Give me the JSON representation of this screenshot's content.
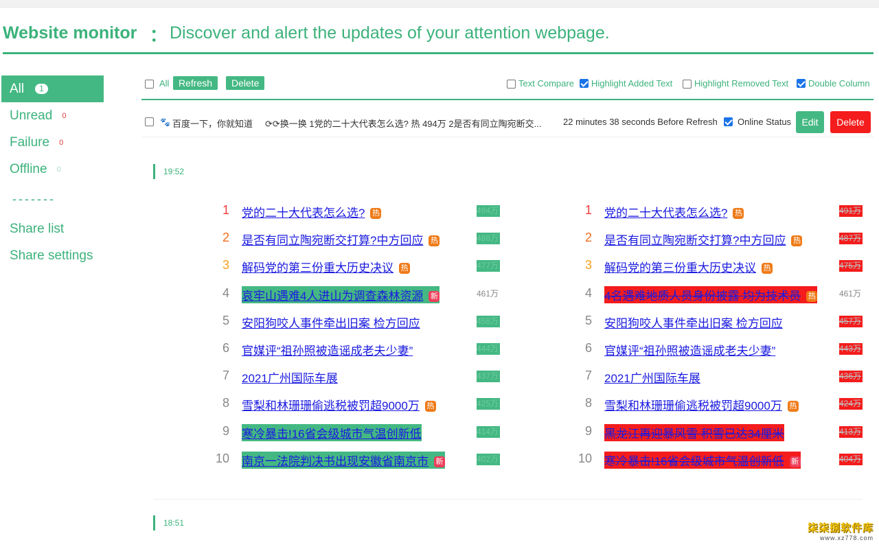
{
  "header": {
    "title": "Website monitor",
    "separator": "：",
    "description": "Discover and alert the updates of your attention webpage."
  },
  "sidebar": {
    "items": [
      {
        "label": "All",
        "count": "1"
      },
      {
        "label": "Unread",
        "count": "0"
      },
      {
        "label": "Failure",
        "count": "0"
      },
      {
        "label": "Offline",
        "count": "0"
      }
    ],
    "separator": "-------",
    "links": [
      "Share list",
      "Share settings"
    ]
  },
  "toolbar": {
    "all_label": "All",
    "refresh_label": "Refresh",
    "delete_label": "Delete",
    "options": [
      {
        "label": "Text Compare",
        "checked": false
      },
      {
        "label": "Highlight Added Text",
        "checked": true
      },
      {
        "label": "Highlight Removed Text",
        "checked": false
      },
      {
        "label": "Double Column",
        "checked": true
      }
    ]
  },
  "item": {
    "favicon": "baidu-paw-icon",
    "site_name": "百度一下，你就知道",
    "snippet": "⟳⟳换一换 1党的二十大代表怎么选? 热 494万 2是否有同立陶宛断交...",
    "before_refresh": "22 minutes 38 seconds Before Refresh",
    "online_status_label": "Online Status",
    "online_checked": true,
    "edit_label": "Edit",
    "delete_label": "Delete"
  },
  "snapshots": [
    {
      "time": "19:52"
    },
    {
      "time": "18:51"
    }
  ],
  "left_list": [
    {
      "rank": "1",
      "title": "党的二十大代表怎么选?",
      "tag": "热",
      "tag_type": "hot",
      "state": "normal",
      "value": "494万",
      "value_state": "added"
    },
    {
      "rank": "2",
      "title": "是否有同立陶宛断交打算?中方回应",
      "tag": "热",
      "tag_type": "hot",
      "state": "normal",
      "value": "488万",
      "value_state": "added"
    },
    {
      "rank": "3",
      "title": "解码党的第三份重大历史决议",
      "tag": "热",
      "tag_type": "hot",
      "state": "normal",
      "value": "477万",
      "value_state": "added"
    },
    {
      "rank": "4",
      "title": "哀牢山遇难4人进山为调查森林资源",
      "tag": "新",
      "tag_type": "new",
      "state": "added",
      "value": "461万",
      "value_state": "normal"
    },
    {
      "rank": "5",
      "title": "安阳狗咬人事件牵出旧案 检方回应",
      "tag": "",
      "tag_type": "",
      "state": "normal",
      "value": "458万",
      "value_state": "added"
    },
    {
      "rank": "6",
      "title": "官媒评“祖孙照被造谣成老夫少妻”",
      "tag": "",
      "tag_type": "",
      "state": "normal",
      "value": "444万",
      "value_state": "added"
    },
    {
      "rank": "7",
      "title": "2021广州国际车展",
      "tag": "",
      "tag_type": "",
      "state": "normal",
      "value": "437万",
      "value_state": "added"
    },
    {
      "rank": "8",
      "title": "雪梨和林珊珊偷逃税被罚超9000万",
      "tag": "热",
      "tag_type": "hot",
      "state": "normal",
      "value": "425万",
      "value_state": "added"
    },
    {
      "rank": "9",
      "title": "寒冷暴击!16省会级城市气温创新低",
      "tag": "",
      "tag_type": "",
      "state": "added",
      "value": "414万",
      "value_state": "added"
    },
    {
      "rank": "10",
      "title": "南京一法院判决书出现安徽省南京市",
      "tag": "新",
      "tag_type": "new",
      "state": "added",
      "value": "402万",
      "value_state": "added"
    }
  ],
  "right_list": [
    {
      "rank": "1",
      "title": "党的二十大代表怎么选?",
      "tag": "热",
      "tag_type": "hot",
      "state": "normal",
      "value": "491万",
      "value_state": "removed"
    },
    {
      "rank": "2",
      "title": "是否有同立陶宛断交打算?中方回应",
      "tag": "热",
      "tag_type": "hot",
      "state": "normal",
      "value": "487万",
      "value_state": "removed"
    },
    {
      "rank": "3",
      "title": "解码党的第三份重大历史决议",
      "tag": "热",
      "tag_type": "hot",
      "state": "normal",
      "value": "475万",
      "value_state": "removed"
    },
    {
      "rank": "4",
      "title": "4名遇难地质人员身份披露 均为技术员",
      "tag": "热",
      "tag_type": "hot",
      "state": "removed",
      "value": "461万",
      "value_state": "normal"
    },
    {
      "rank": "5",
      "title": "安阳狗咬人事件牵出旧案 检方回应",
      "tag": "",
      "tag_type": "",
      "state": "normal",
      "value": "457万",
      "value_state": "removed"
    },
    {
      "rank": "6",
      "title": "官媒评“祖孙照被造谣成老夫少妻”",
      "tag": "",
      "tag_type": "",
      "state": "normal",
      "value": "443万",
      "value_state": "removed"
    },
    {
      "rank": "7",
      "title": "2021广州国际车展",
      "tag": "",
      "tag_type": "",
      "state": "normal",
      "value": "436万",
      "value_state": "removed"
    },
    {
      "rank": "8",
      "title": "雪梨和林珊珊偷逃税被罚超9000万",
      "tag": "热",
      "tag_type": "hot",
      "state": "normal",
      "value": "424万",
      "value_state": "removed"
    },
    {
      "rank": "9",
      "title": "黑龙江再迎暴风雪 积雪已达34厘米",
      "tag": "",
      "tag_type": "",
      "state": "removed",
      "value": "413万",
      "value_state": "removed"
    },
    {
      "rank": "10",
      "title": "寒冷暴击!16省会级城市气温创新低",
      "tag": "新",
      "tag_type": "new",
      "state": "removed",
      "value": "404万",
      "value_state": "removed"
    }
  ],
  "watermark": {
    "cn": "柒柒捌软件库",
    "url": "www.xz778.com"
  },
  "colors": {
    "accent": "#3cb27b",
    "added": "#44b883",
    "removed": "#f41c1c",
    "link": "#1a1ae0"
  }
}
